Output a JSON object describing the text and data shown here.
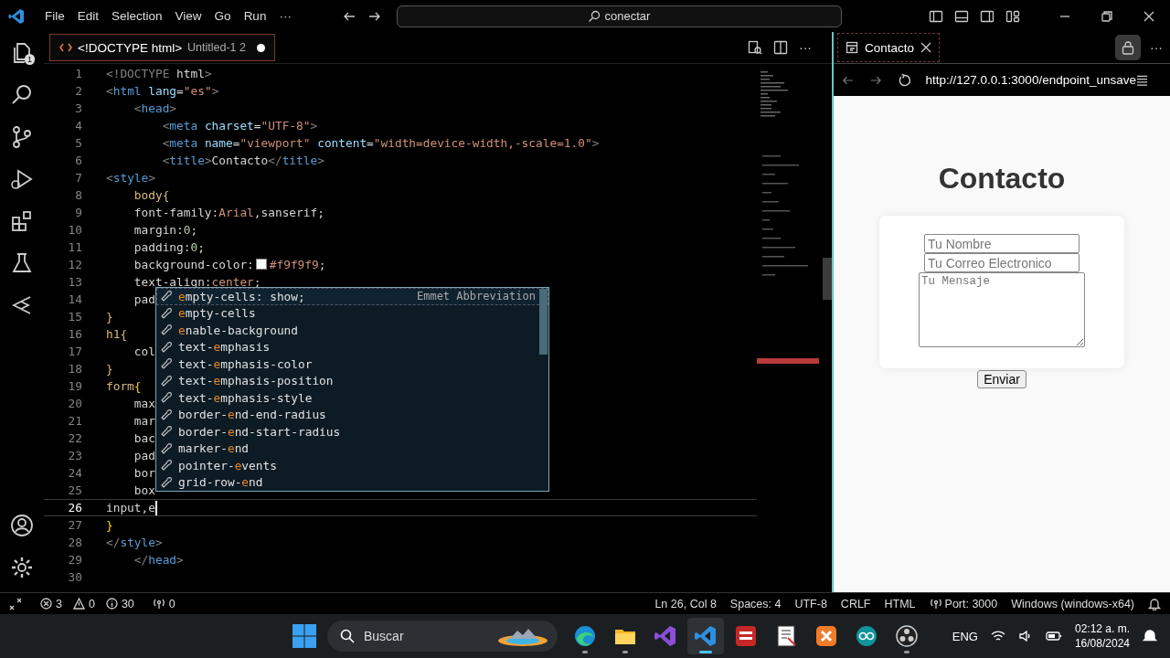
{
  "title_bar": {
    "menu": [
      "File",
      "Edit",
      "Selection",
      "View",
      "Go",
      "Run"
    ],
    "more": "···",
    "command_center": "conectar"
  },
  "activity_bar": {
    "explorer_badge": "1"
  },
  "editor": {
    "tabs": [
      {
        "title": "<!DOCTYPE html>",
        "description": "Untitled-1 2",
        "selected": true,
        "dirty": true
      }
    ],
    "more": "···",
    "lines": [
      {
        "number": "1",
        "current": false,
        "tokens": [
          {
            "kind": "p",
            "text": "<!DOCTYPE"
          },
          {
            "kind": "txt",
            "text": " html"
          },
          {
            "kind": "p",
            "text": ">"
          }
        ]
      },
      {
        "number": "2",
        "current": false,
        "tokens": [
          {
            "kind": "p",
            "text": "<"
          },
          {
            "kind": "tag",
            "text": "html"
          },
          {
            "kind": "attr",
            "text": " lang"
          },
          {
            "kind": "txt",
            "text": "="
          },
          {
            "kind": "str",
            "text": "\"es\""
          },
          {
            "kind": "p",
            "text": ">"
          }
        ]
      },
      {
        "number": "3",
        "current": false,
        "tokens": [
          {
            "kind": "p",
            "text": "    <"
          },
          {
            "kind": "tag",
            "text": "head"
          },
          {
            "kind": "p",
            "text": ">"
          }
        ]
      },
      {
        "number": "4",
        "current": false,
        "tokens": [
          {
            "kind": "p",
            "text": "        <"
          },
          {
            "kind": "tag",
            "text": "meta"
          },
          {
            "kind": "attr",
            "text": " charset"
          },
          {
            "kind": "txt",
            "text": "="
          },
          {
            "kind": "str",
            "text": "\"UTF-8\""
          },
          {
            "kind": "p",
            "text": ">"
          }
        ]
      },
      {
        "number": "5",
        "current": false,
        "tokens": [
          {
            "kind": "p",
            "text": "        <"
          },
          {
            "kind": "tag",
            "text": "meta"
          },
          {
            "kind": "attr",
            "text": " name"
          },
          {
            "kind": "txt",
            "text": "="
          },
          {
            "kind": "str",
            "text": "\"viewport\""
          },
          {
            "kind": "attr",
            "text": " content"
          },
          {
            "kind": "txt",
            "text": "="
          },
          {
            "kind": "str",
            "text": "\"width=device-width,-scale=1.0\""
          },
          {
            "kind": "p",
            "text": ">"
          }
        ]
      },
      {
        "number": "6",
        "current": false,
        "tokens": [
          {
            "kind": "p",
            "text": "        <"
          },
          {
            "kind": "tag",
            "text": "title"
          },
          {
            "kind": "p",
            "text": ">"
          },
          {
            "kind": "txt",
            "text": "Contacto"
          },
          {
            "kind": "p",
            "text": "</"
          },
          {
            "kind": "tag",
            "text": "title"
          },
          {
            "kind": "p",
            "text": ">"
          }
        ]
      },
      {
        "number": "7",
        "current": false,
        "tokens": [
          {
            "kind": "p",
            "text": "<"
          },
          {
            "kind": "tag",
            "text": "style"
          },
          {
            "kind": "p",
            "text": ">"
          }
        ]
      },
      {
        "number": "8",
        "current": false,
        "tokens": [
          {
            "kind": "sel",
            "text": "    body{"
          }
        ]
      },
      {
        "number": "9",
        "current": false,
        "tokens": [
          {
            "kind": "txt",
            "text": "    font-family:"
          },
          {
            "kind": "str",
            "text": "Arial"
          },
          {
            "kind": "txt",
            "text": ",sanserif;"
          }
        ]
      },
      {
        "number": "10",
        "current": false,
        "tokens": [
          {
            "kind": "txt",
            "text": "    margin:"
          },
          {
            "kind": "num",
            "text": "0"
          },
          {
            "kind": "txt",
            "text": ";"
          }
        ]
      },
      {
        "number": "11",
        "current": false,
        "tokens": [
          {
            "kind": "txt",
            "text": "    padding:"
          },
          {
            "kind": "num",
            "text": "0"
          },
          {
            "kind": "txt",
            "text": ";"
          }
        ]
      },
      {
        "number": "12",
        "current": false,
        "tokens": [
          {
            "kind": "txt",
            "text": "    background-color:"
          },
          {
            "kind": "swatch",
            "color": "#f9f9f9"
          },
          {
            "kind": "str",
            "text": "#f9f9f9"
          },
          {
            "kind": "txt",
            "text": ";"
          }
        ]
      },
      {
        "number": "13",
        "current": false,
        "tokens": [
          {
            "kind": "txt",
            "text": "    text-align:"
          },
          {
            "kind": "str",
            "text": "center"
          },
          {
            "kind": "txt",
            "text": ";"
          }
        ]
      },
      {
        "number": "14",
        "current": false,
        "tokens": [
          {
            "kind": "txt",
            "text": "    pad"
          }
        ]
      },
      {
        "number": "15",
        "current": false,
        "tokens": [
          {
            "kind": "sel",
            "text": "}"
          }
        ]
      },
      {
        "number": "16",
        "current": false,
        "tokens": [
          {
            "kind": "sel",
            "text": "h1{"
          }
        ]
      },
      {
        "number": "17",
        "current": false,
        "tokens": [
          {
            "kind": "txt",
            "text": "    col"
          }
        ]
      },
      {
        "number": "18",
        "current": false,
        "tokens": [
          {
            "kind": "sel",
            "text": "}"
          }
        ]
      },
      {
        "number": "19",
        "current": false,
        "tokens": [
          {
            "kind": "sel",
            "text": "form"
          },
          {
            "kind": "brace",
            "text": "{"
          }
        ]
      },
      {
        "number": "20",
        "current": false,
        "tokens": [
          {
            "kind": "txt",
            "text": "    max"
          }
        ]
      },
      {
        "number": "21",
        "current": false,
        "tokens": [
          {
            "kind": "txt",
            "text": "    mar"
          }
        ]
      },
      {
        "number": "22",
        "current": false,
        "tokens": [
          {
            "kind": "txt",
            "text": "    bac"
          }
        ]
      },
      {
        "number": "23",
        "current": false,
        "tokens": [
          {
            "kind": "txt",
            "text": "    pad"
          }
        ]
      },
      {
        "number": "24",
        "current": false,
        "tokens": [
          {
            "kind": "txt",
            "text": "    bor"
          }
        ]
      },
      {
        "number": "25",
        "current": false,
        "tokens": [
          {
            "kind": "txt",
            "text": "    box"
          }
        ]
      },
      {
        "number": "26",
        "current": true,
        "tokens": [
          {
            "kind": "txt",
            "text": "input,e"
          }
        ]
      },
      {
        "number": "27",
        "current": false,
        "tokens": [
          {
            "kind": "brace",
            "text": "}"
          }
        ]
      },
      {
        "number": "28",
        "current": false,
        "tokens": [
          {
            "kind": "p",
            "text": "</"
          },
          {
            "kind": "tag",
            "text": "style"
          },
          {
            "kind": "p",
            "text": ">"
          }
        ]
      },
      {
        "number": "29",
        "current": false,
        "tokens": [
          {
            "kind": "p",
            "text": "    </"
          },
          {
            "kind": "tag",
            "text": "head"
          },
          {
            "kind": "p",
            "text": ">"
          }
        ]
      },
      {
        "number": "30",
        "current": false
      }
    ],
    "suggestions": [
      {
        "label": "**e**mpty-cells: show;",
        "detail": "Emmet Abbreviation",
        "selected": true
      },
      {
        "label": "**e**mpty-cells",
        "selected": false
      },
      {
        "label": "**e**nable-background",
        "selected": false
      },
      {
        "label": "text-**e**mphasis",
        "selected": false
      },
      {
        "label": "text-**e**mphasis-color",
        "selected": false
      },
      {
        "label": "text-**e**mphasis-position",
        "selected": false
      },
      {
        "label": "text-**e**mphasis-style",
        "selected": false
      },
      {
        "label": "border-**e**nd-end-radius",
        "selected": false
      },
      {
        "label": "border-**e**nd-start-radius",
        "selected": false
      },
      {
        "label": "marker-**e**nd",
        "selected": false
      },
      {
        "label": "pointer-**e**vents",
        "selected": false
      },
      {
        "label": "grid-row-**e**nd",
        "selected": false
      }
    ]
  },
  "browser": {
    "tab": {
      "title": "Contacto"
    },
    "locked": true,
    "more": "···",
    "url": "http://127.0.0.1:3000/endpoint_unsave",
    "page": {
      "heading": "Contacto",
      "fields": [
        {
          "kind": "input",
          "placeholder": "Tu Nombre"
        },
        {
          "kind": "input",
          "placeholder": "Tu Correo Electronico"
        },
        {
          "kind": "textarea",
          "placeholder": "Tu Mensaje"
        }
      ],
      "button": "Enviar"
    }
  },
  "status_bar": {
    "errors": "3",
    "warnings": "0",
    "infos": "30",
    "ports": "0",
    "right": [
      {
        "kind": "text",
        "text": "Ln 26, Col 8"
      },
      {
        "kind": "text",
        "text": "Spaces: 4"
      },
      {
        "kind": "text",
        "text": "UTF-8"
      },
      {
        "kind": "text",
        "text": "CRLF"
      },
      {
        "kind": "text",
        "text": "HTML"
      },
      {
        "kind": "port",
        "text": "Port: 3000"
      },
      {
        "kind": "text",
        "text": "Windows (windows-x64)"
      }
    ]
  },
  "taskbar": {
    "search": "Buscar",
    "apps": [
      {
        "kind": "edge",
        "running": true,
        "selected": false
      },
      {
        "kind": "folder",
        "running": true,
        "selected": false
      },
      {
        "kind": "studio",
        "running": false,
        "selected": false
      },
      {
        "kind": "vscode",
        "running": true,
        "selected": true
      },
      {
        "kind": "devcpp",
        "running": false,
        "selected": false
      },
      {
        "kind": "doc",
        "running": false,
        "selected": false
      },
      {
        "kind": "xampp",
        "running": false,
        "selected": false
      },
      {
        "kind": "arduino",
        "running": false,
        "selected": false
      },
      {
        "kind": "obs",
        "running": true,
        "selected": false
      }
    ],
    "language": "ENG",
    "time": "02:12 a. m.",
    "date": "16/08/2024"
  }
}
